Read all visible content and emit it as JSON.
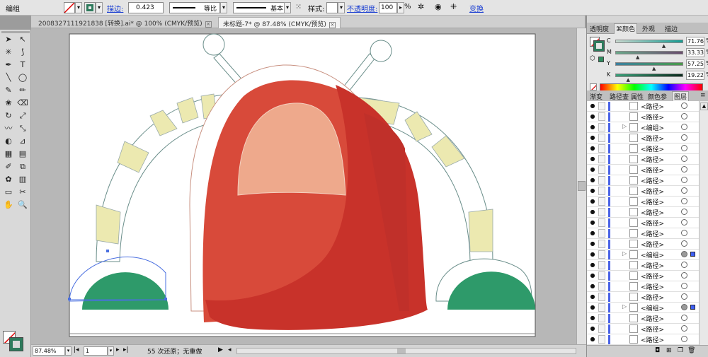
{
  "toolbar": {
    "mode_label": "编组",
    "stroke_label": "描边:",
    "stroke_value": "0.423",
    "profile_label": "等比",
    "brush_label": "基本",
    "style_label": "样式:",
    "opacity_label": "不透明度:",
    "opacity_value": "100",
    "opacity_unit": "%",
    "transform_label": "变换"
  },
  "tabs": [
    {
      "label": "2008327111921838 [转换].ai* @ 100% (CMYK/预览)"
    },
    {
      "label": "未标题-7* @ 87.48% (CMYK/预览)"
    }
  ],
  "tools": [
    "selection-tool",
    "direct-selection-tool",
    "magic-wand-tool",
    "lasso-tool",
    "pen-tool",
    "type-tool",
    "line-tool",
    "ellipse-tool",
    "paintbrush-tool",
    "pencil-tool",
    "blob-brush-tool",
    "eraser-tool",
    "rotate-tool",
    "scale-tool",
    "warp-tool",
    "free-transform-tool",
    "shape-builder-tool",
    "perspective-tool",
    "mesh-tool",
    "gradient-tool",
    "eyedropper-tool",
    "blend-tool",
    "symbol-sprayer-tool",
    "column-graph-tool",
    "artboard-tool",
    "slice-tool",
    "hand-tool",
    "zoom-tool"
  ],
  "status": {
    "zoom": "87.48%",
    "page": "1",
    "history": "55 次还原；无重做"
  },
  "panel_color": {
    "tabs": [
      "透明度",
      "颜色",
      "外观",
      "描边"
    ],
    "channels": [
      {
        "label": "C",
        "value": "71.76",
        "pos": 0.7176
      },
      {
        "label": "M",
        "value": "33.33",
        "pos": 0.3333
      },
      {
        "label": "Y",
        "value": "57.25",
        "pos": 0.5725
      },
      {
        "label": "K",
        "value": "19.22",
        "pos": 0.1922
      }
    ],
    "unit": "%",
    "fill_color": "#2e8b5e"
  },
  "panel_layers": {
    "tabs": [
      "渐变",
      "路径查",
      "属性",
      "颜色参",
      "图层"
    ],
    "rows": [
      {
        "name": "<路径>",
        "type": "path"
      },
      {
        "name": "<路径>",
        "type": "path"
      },
      {
        "name": "<编组>",
        "type": "group"
      },
      {
        "name": "<路径>",
        "type": "path"
      },
      {
        "name": "<路径>",
        "type": "path"
      },
      {
        "name": "<路径>",
        "type": "path"
      },
      {
        "name": "<路径>",
        "type": "path"
      },
      {
        "name": "<路径>",
        "type": "path"
      },
      {
        "name": "<路径>",
        "type": "path"
      },
      {
        "name": "<路径>",
        "type": "path"
      },
      {
        "name": "<路径>",
        "type": "path"
      },
      {
        "name": "<路径>",
        "type": "path"
      },
      {
        "name": "<路径>",
        "type": "path"
      },
      {
        "name": "<路径>",
        "type": "path"
      },
      {
        "name": "<编组>",
        "type": "group",
        "selected": true
      },
      {
        "name": "<路径>",
        "type": "path"
      },
      {
        "name": "<路径>",
        "type": "path"
      },
      {
        "name": "<路径>",
        "type": "path"
      },
      {
        "name": "<路径>",
        "type": "path"
      },
      {
        "name": "<编组>",
        "type": "group",
        "selected": true
      },
      {
        "name": "<路径>",
        "type": "path"
      },
      {
        "name": "<路径>",
        "type": "path"
      },
      {
        "name": "<路径>",
        "type": "path"
      }
    ]
  },
  "colors": {
    "helmet_red": "#d84a3a",
    "helmet_dark": "#c8322a",
    "visor": "#eea98c",
    "arm_yellow": "#ece9b0",
    "foot_green": "#2e9a6a",
    "selection_blue": "#4a6fe0"
  }
}
